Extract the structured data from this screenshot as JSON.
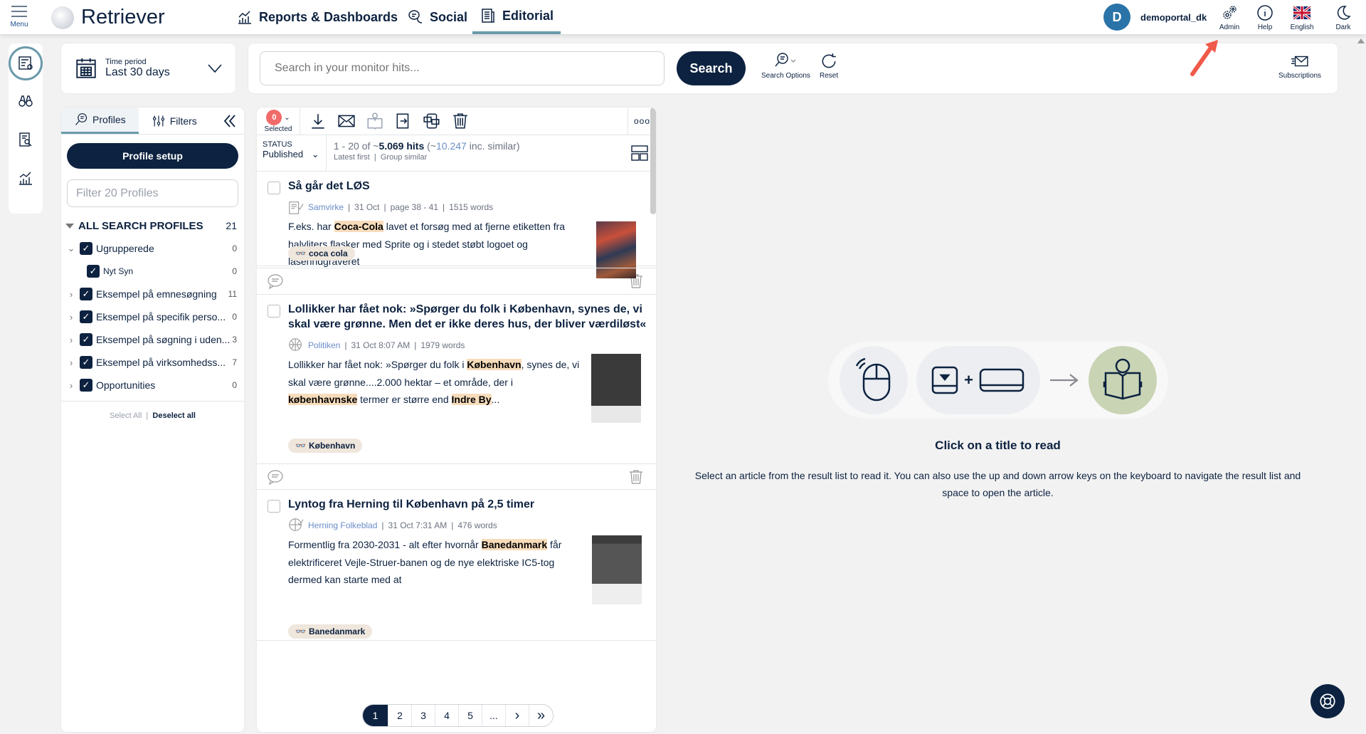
{
  "topbar": {
    "menu_label": "Menu",
    "brand": "Retriever",
    "nav": [
      {
        "label": "Reports & Dashboards"
      },
      {
        "label": "Social"
      },
      {
        "label": "Editorial"
      }
    ],
    "user_initial": "D",
    "username": "demoportal_dk",
    "tools": [
      {
        "label": "Admin"
      },
      {
        "label": "Help"
      },
      {
        "label": "English"
      },
      {
        "label": "Dark"
      }
    ]
  },
  "time_period": {
    "label": "Time period",
    "value": "Last 30 days"
  },
  "search": {
    "placeholder": "Search in your monitor hits...",
    "button": "Search",
    "options_label": "Search Options",
    "reset_label": "Reset",
    "subscriptions_label": "Subscriptions"
  },
  "left_panel": {
    "tabs": [
      {
        "label": "Profiles"
      },
      {
        "label": "Filters"
      }
    ],
    "profile_setup": "Profile setup",
    "filter_placeholder": "Filter 20 Profiles",
    "all_label": "ALL SEARCH PROFILES",
    "all_count": "21",
    "profiles": [
      {
        "name": "Ugrupperede",
        "count": "0"
      },
      {
        "name": "Nyt Syn",
        "count": "0"
      },
      {
        "name": "Eksempel på emnesøgning",
        "count": "11"
      },
      {
        "name": "Eksempel på specifik perso...",
        "count": "0"
      },
      {
        "name": "Eksempel på søgning i uden...",
        "count": "3"
      },
      {
        "name": "Eksempel på virksomhedss...",
        "count": "7"
      },
      {
        "name": "Opportunities",
        "count": "0"
      }
    ],
    "select_all": "Select All",
    "deselect_all": "Deselect all"
  },
  "results": {
    "selected_count": "0",
    "selected_label": "Selected",
    "more": "ooo",
    "status_label": "STATUS",
    "status_value": "Published",
    "range": "1 - 20 of ~",
    "hits": "5.069 hits",
    "similar_open": " (~",
    "similar_num": "10.247",
    "similar_close": " inc. similar)",
    "sort": "Latest first",
    "group": "Group similar",
    "articles": [
      {
        "title": "Så går det LØS",
        "source": "Samvirke",
        "date": "31 Oct",
        "page": "page 38 - 41",
        "words": "1515 words",
        "t1": "F.eks. har ",
        "h1": "Coca-Cola",
        "t2": " lavet et forsøg med at fjerne etiketten fra halvliters flasker med Sprite og i stedet støbt logoet og laserindgraveret",
        "tag": "coca cola"
      },
      {
        "title": "Lollikker har fået nok: »Spørger du folk i København, synes de, vi skal være grønne. Men det er ikke deres hus, der bliver værdiløst«",
        "source": "Politiken",
        "date": "31 Oct 8:07 AM",
        "words": "1979 words",
        "t1": "Lollikker har fået nok: »Spørger du folk i ",
        "h1": "København",
        "t2": ", synes de, vi skal være grønne....2.000 hektar – et område, der i ",
        "h2": "københavnske",
        "t3": " termer er større end ",
        "h3": "Indre By",
        "t4": "...",
        "tag": "København"
      },
      {
        "title": "Lyntog fra Herning til København på 2,5 timer",
        "source": "Herning Folkeblad",
        "date": "31 Oct 7:31 AM",
        "words": "476 words",
        "t1": "Formentlig fra 2030-2031 - alt efter hvornår ",
        "h1": "Banedanmark",
        "t2": " får elektrificeret Vejle-Struer-banen og de nye elektriske IC5-tog dermed kan starte med at",
        "tag": "Banedanmark"
      }
    ],
    "pages": [
      "1",
      "2",
      "3",
      "4",
      "5",
      "...",
      "›",
      "»"
    ],
    "current_page": "1"
  },
  "reader": {
    "title": "Click on a title to read",
    "description": "Select an article from the result list to read it. You can also use the up and down arrow keys on the keyboard to navigate the result list and space to open the article.",
    "plus": "+"
  },
  "colors": {
    "navy": "#0d2240",
    "accent": "#6b9aab",
    "highlight": "#f7dcbb",
    "badge": "#f26b6b",
    "arrow": "#f05a4a"
  }
}
